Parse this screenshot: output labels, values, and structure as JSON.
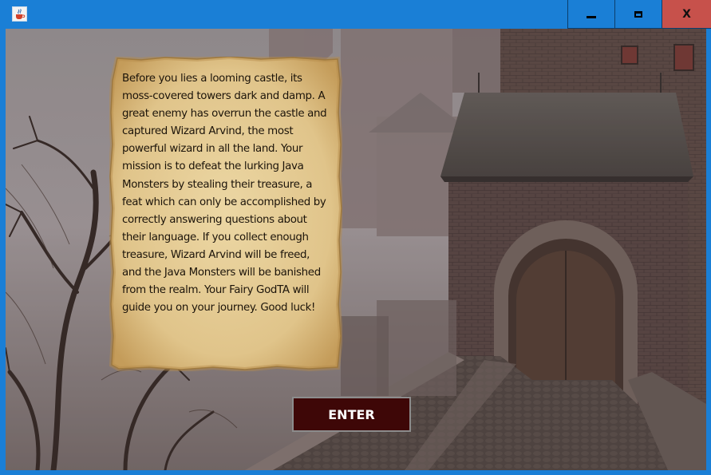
{
  "window": {
    "app_icon": "java-cup-icon",
    "controls": {
      "minimize_icon": "minimize-icon",
      "maximize_icon": "maximize-icon",
      "close_label": "X"
    }
  },
  "intro": {
    "story_text": "Before you lies a looming castle, its moss-covered towers dark and damp. A great enemy has overrun the castle and captured Wizard Arvind, the most powerful wizard in all the land. Your mission is to defeat the lurking Java Monsters by stealing their treasure, a feat which can only be accomplished by correctly answering questions about their language. If you collect enough treasure, Wizard Arvind will be freed, and the Java Monsters will be banished from the realm. Your Fairy GodTA will guide you on your journey. Good luck!",
    "enter_label": "ENTER"
  },
  "colors": {
    "titlebar": "#1a7fd6",
    "close_button": "#c7514b",
    "enter_button": "#3e0707",
    "parchment": "#e6cf98"
  }
}
